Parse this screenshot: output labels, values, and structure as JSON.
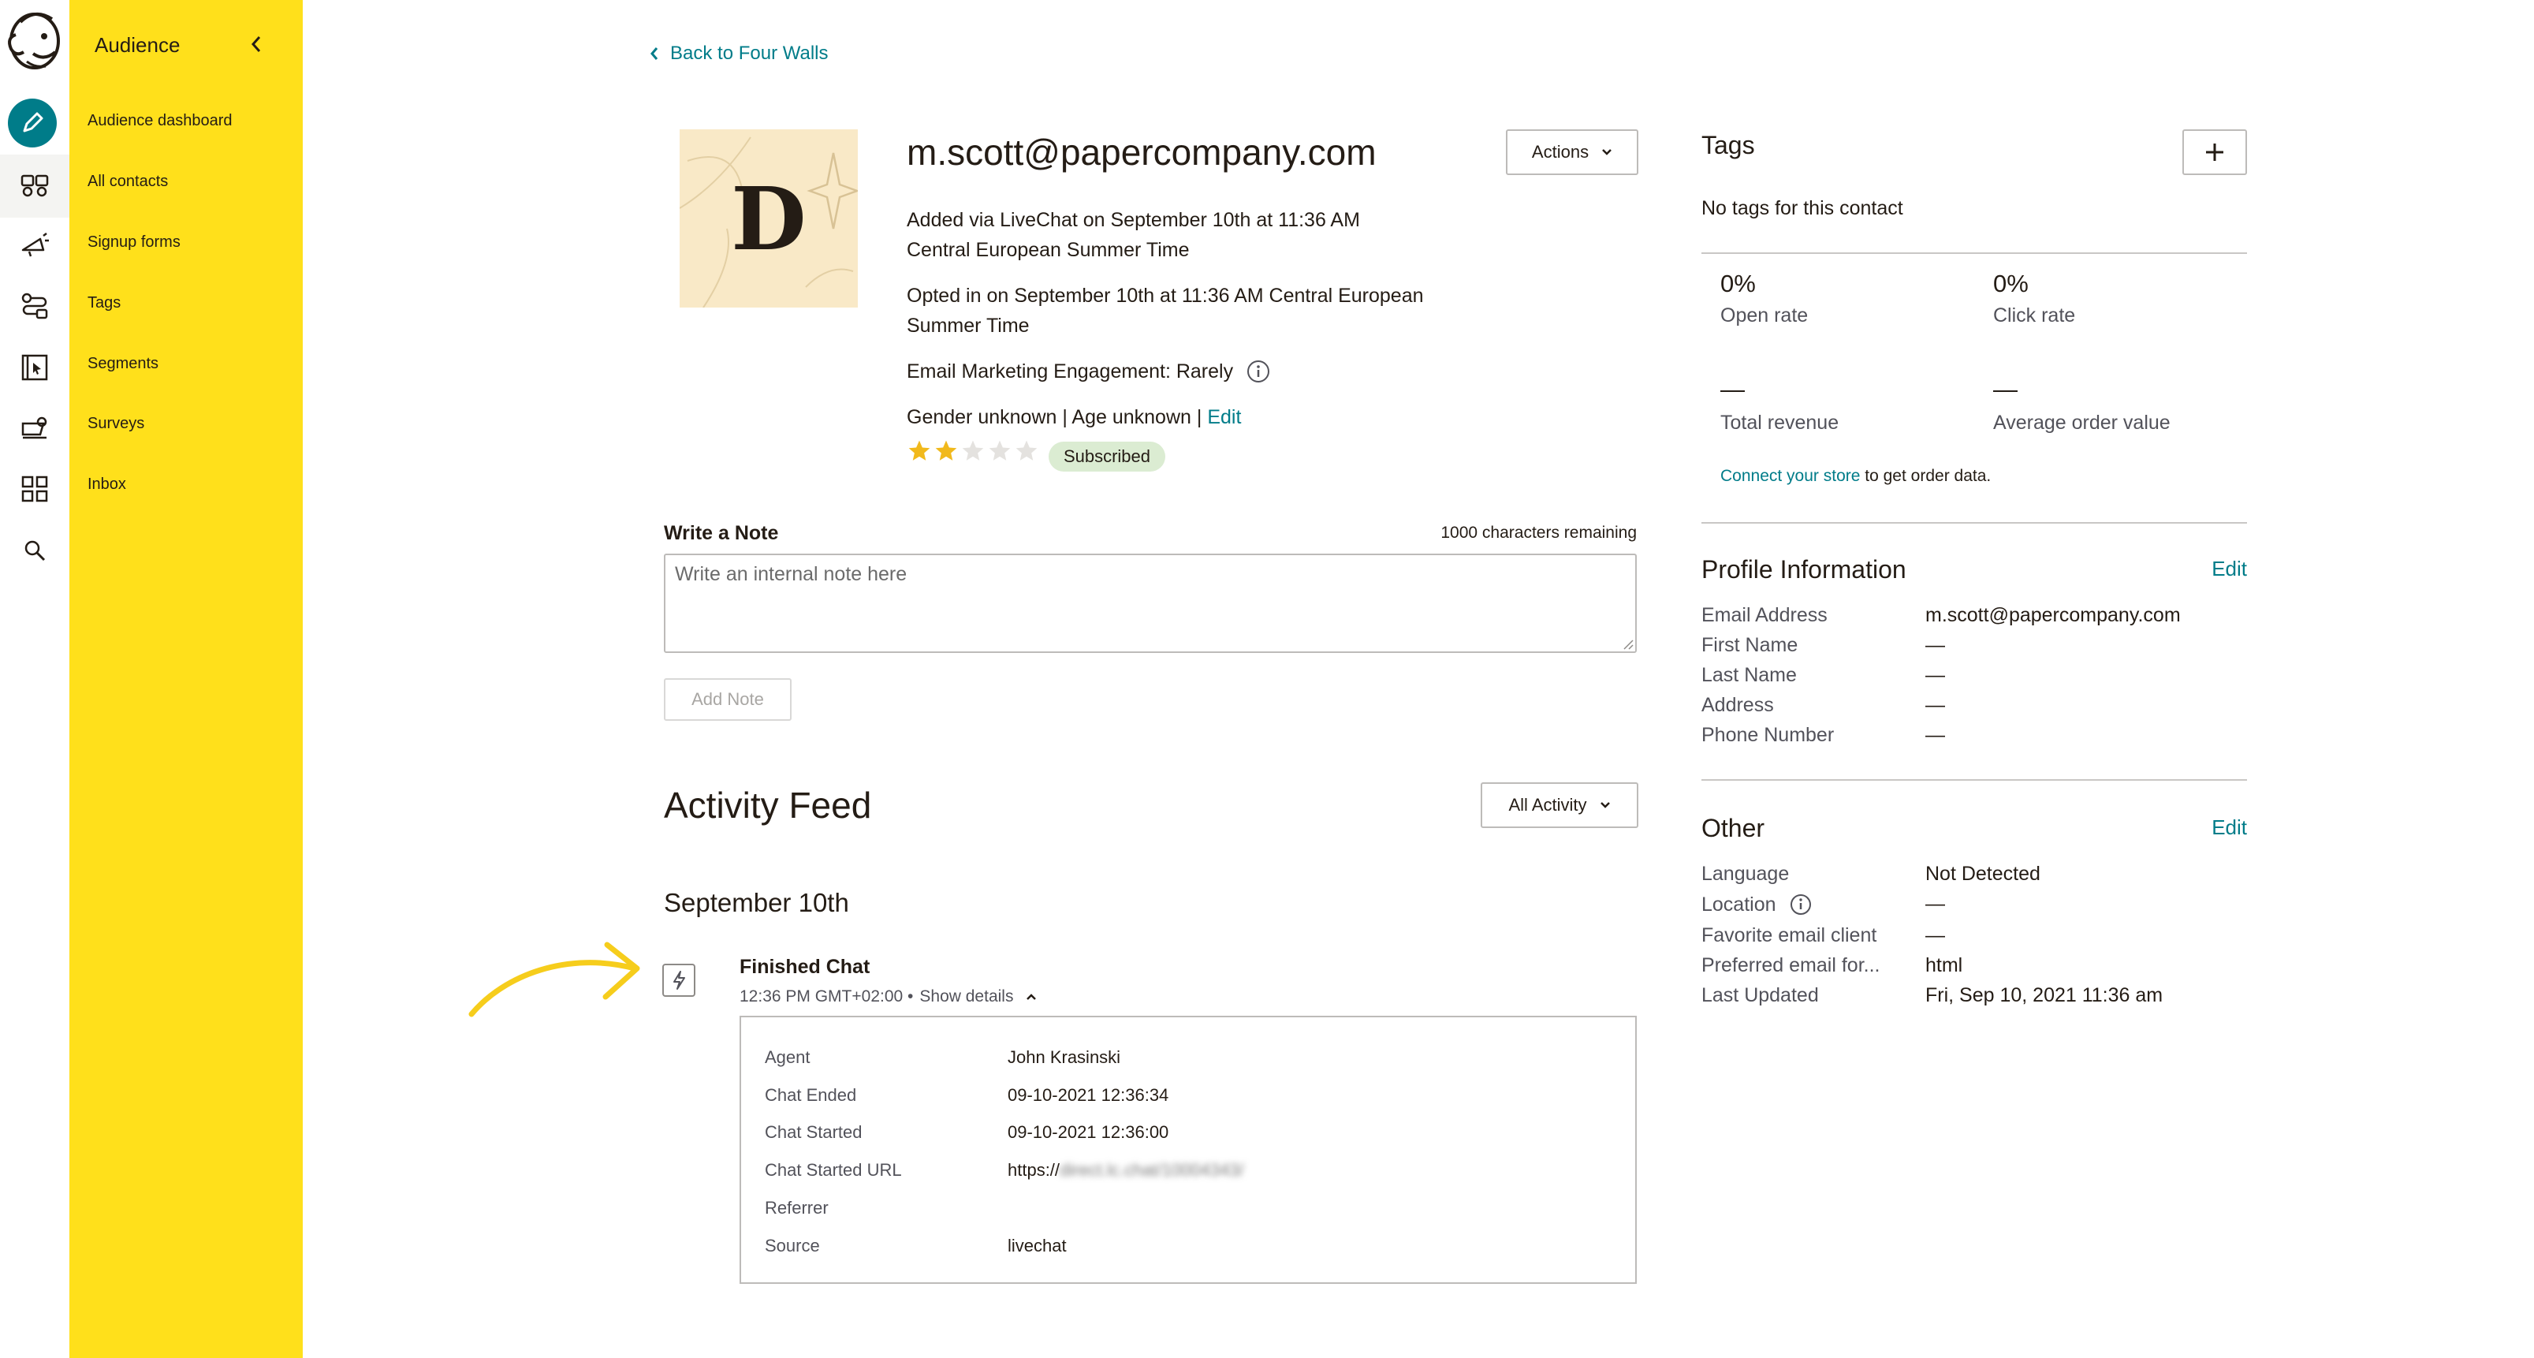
{
  "sidebar": {
    "title": "Audience",
    "items": [
      {
        "label": "Audience dashboard"
      },
      {
        "label": "All contacts"
      },
      {
        "label": "Signup forms"
      },
      {
        "label": "Tags"
      },
      {
        "label": "Segments"
      },
      {
        "label": "Surveys"
      },
      {
        "label": "Inbox"
      }
    ]
  },
  "rail": {
    "icons": [
      "mailchimp-logo",
      "pencil-icon",
      "audience-icon",
      "campaigns-icon",
      "automations-icon",
      "website-icon",
      "content-icon",
      "integrations-icon",
      "search-icon"
    ]
  },
  "back_link": "Back to Four Walls",
  "contact": {
    "avatar_letter": "D",
    "email": "m.scott@papercompany.com",
    "added_line1": "Added via LiveChat on September 10th at 11:36 AM",
    "added_line2": "Central European Summer Time",
    "opted_line1": "Opted in on September 10th at 11:36 AM Central European",
    "opted_line2": "Summer Time",
    "engagement": "Email Marketing Engagement: Rarely",
    "demographics": "Gender unknown | Age unknown |",
    "edit_label": "Edit",
    "rating": 2,
    "rating_max": 5,
    "status": "Subscribed"
  },
  "actions_button": "Actions",
  "note": {
    "label": "Write a Note",
    "remaining": "1000 characters remaining",
    "placeholder": "Write an internal note here",
    "button": "Add Note"
  },
  "feed": {
    "title": "Activity Feed",
    "filter": "All Activity",
    "date": "September 10th",
    "event": {
      "title": "Finished Chat",
      "time": "12:36 PM GMT+02:00 •",
      "toggle": "Show details",
      "rows": [
        {
          "key": "Agent",
          "value": "John Krasinski"
        },
        {
          "key": "Chat Ended",
          "value": "09-10-2021 12:36:34"
        },
        {
          "key": "Chat Started",
          "value": "09-10-2021 12:36:00"
        },
        {
          "key": "Chat Started URL",
          "value": "https://",
          "blurred": "direct.lc.chat/10004343/"
        },
        {
          "key": "Referrer",
          "value": ""
        },
        {
          "key": "Source",
          "value": "livechat"
        }
      ]
    }
  },
  "tags": {
    "title": "Tags",
    "empty": "No tags for this contact"
  },
  "stats": {
    "open_rate_value": "0%",
    "open_rate_label": "Open rate",
    "click_rate_value": "0%",
    "click_rate_label": "Click rate",
    "revenue_value": "—",
    "revenue_label": "Total revenue",
    "aov_value": "—",
    "aov_label": "Average order value",
    "connect_link": "Connect your store",
    "connect_rest": "to get order data."
  },
  "profile": {
    "title": "Profile Information",
    "edit": "Edit",
    "rows": [
      {
        "key": "Email Address",
        "value": "m.scott@papercompany.com"
      },
      {
        "key": "First Name",
        "value": "—"
      },
      {
        "key": "Last Name",
        "value": "—"
      },
      {
        "key": "Address",
        "value": "—"
      },
      {
        "key": "Phone Number",
        "value": "—"
      }
    ]
  },
  "other": {
    "title": "Other",
    "edit": "Edit",
    "rows": [
      {
        "key": "Language",
        "value": "Not Detected"
      },
      {
        "key": "Location",
        "value": "—"
      },
      {
        "key": "Favorite email client",
        "value": "—"
      },
      {
        "key": "Preferred email for...",
        "value": "html"
      },
      {
        "key": "Last Updated",
        "value": "Fri, Sep 10, 2021 11:36 am"
      }
    ]
  },
  "colors": {
    "sidebar": "#ffe01b",
    "accent": "#007c89",
    "badge": "#dbecd2",
    "star": "#f1b91c",
    "annotation_arrow": "#f6cd1c"
  }
}
